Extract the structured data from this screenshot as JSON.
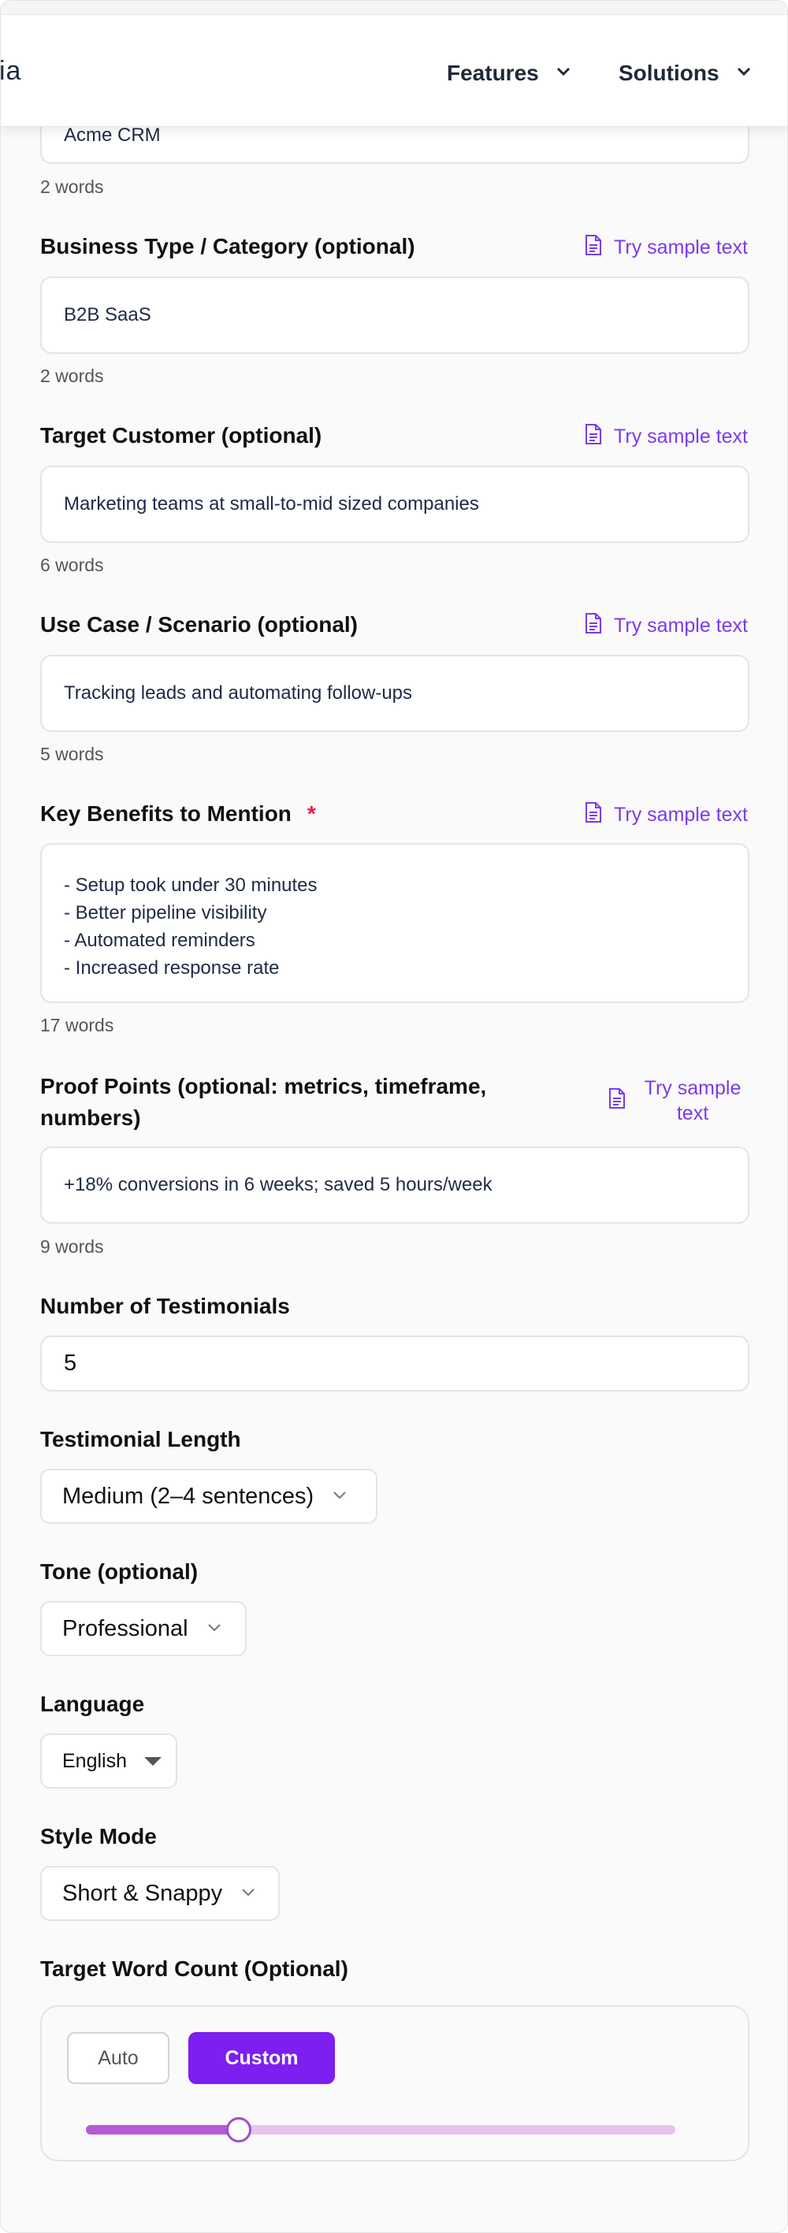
{
  "header": {
    "logo_fragment": "ia",
    "nav": [
      {
        "label": "Features"
      },
      {
        "label": "Solutions"
      }
    ]
  },
  "fields": {
    "product_name": {
      "value": "Acme CRM",
      "count": "2 words"
    },
    "business_type": {
      "label": "Business Type / Category (optional)",
      "value": "B2B SaaS",
      "count": "2 words"
    },
    "target_customer": {
      "label": "Target Customer (optional)",
      "value": "Marketing teams at small-to-mid sized companies",
      "count": "6 words"
    },
    "use_case": {
      "label": "Use Case / Scenario (optional)",
      "value": "Tracking leads and automating follow-ups",
      "count": "5 words"
    },
    "key_benefits": {
      "label": "Key Benefits to Mention",
      "required_mark": "*",
      "lines": [
        "- Setup took under 30 minutes",
        "- Better pipeline visibility",
        "- Automated reminders",
        "- Increased response rate"
      ],
      "count": "17 words"
    },
    "proof_points": {
      "label_line1": "Proof Points (optional: metrics, timeframe,",
      "label_line2": "numbers)",
      "value": "+18% conversions in 6 weeks; saved 5 hours/week",
      "count": "9 words"
    }
  },
  "sample_link": {
    "label": "Try sample text",
    "label_line1": "Try sample",
    "label_line2": "text"
  },
  "num_testimonials": {
    "label": "Number of Testimonials",
    "value": "5"
  },
  "testimonial_length": {
    "label": "Testimonial Length",
    "selected": "Medium (2–4 sentences)"
  },
  "tone": {
    "label": "Tone (optional)",
    "selected": "Professional"
  },
  "language": {
    "label": "Language",
    "selected": "English"
  },
  "style_mode": {
    "label": "Style Mode",
    "selected": "Short & Snappy"
  },
  "word_count": {
    "label": "Target Word Count (Optional)",
    "auto_label": "Auto",
    "custom_label": "Custom",
    "slider_fraction": 0.26
  },
  "colors": {
    "accent": "#7c1ff0",
    "link": "#7c3aed",
    "required": "#e11d48"
  }
}
